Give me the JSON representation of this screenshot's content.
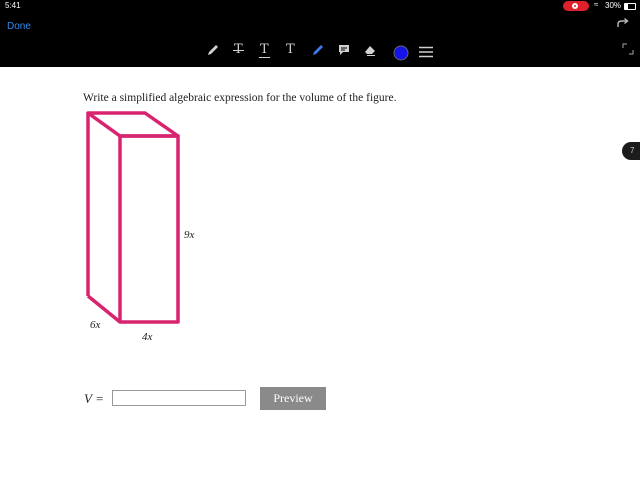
{
  "status_bar": {
    "time": "5:41",
    "battery": "30%",
    "recording_color": "#e0202a",
    "wifi_icon": "wifi-icon"
  },
  "toolbar": {
    "done_label": "Done",
    "tools": [
      "pencil-icon",
      "strikethrough-text-icon",
      "underline-text-icon",
      "text-icon",
      "pen-icon",
      "comment-icon",
      "eraser-icon",
      "color-icon",
      "menu-icon"
    ],
    "selected_color": "#1414e6",
    "accent_color": "#2d8cf0"
  },
  "question": {
    "prompt": "Write a simplified algebraic expression for the volume of the figure.",
    "figure": {
      "height_label": "9x",
      "depth_label": "6x",
      "width_label": "4x",
      "stroke_color": "#d8246e"
    },
    "answer_var": "V",
    "equals": "=",
    "answer_value": "",
    "preview_label": "Preview"
  },
  "side_tab": {
    "label": "7"
  }
}
